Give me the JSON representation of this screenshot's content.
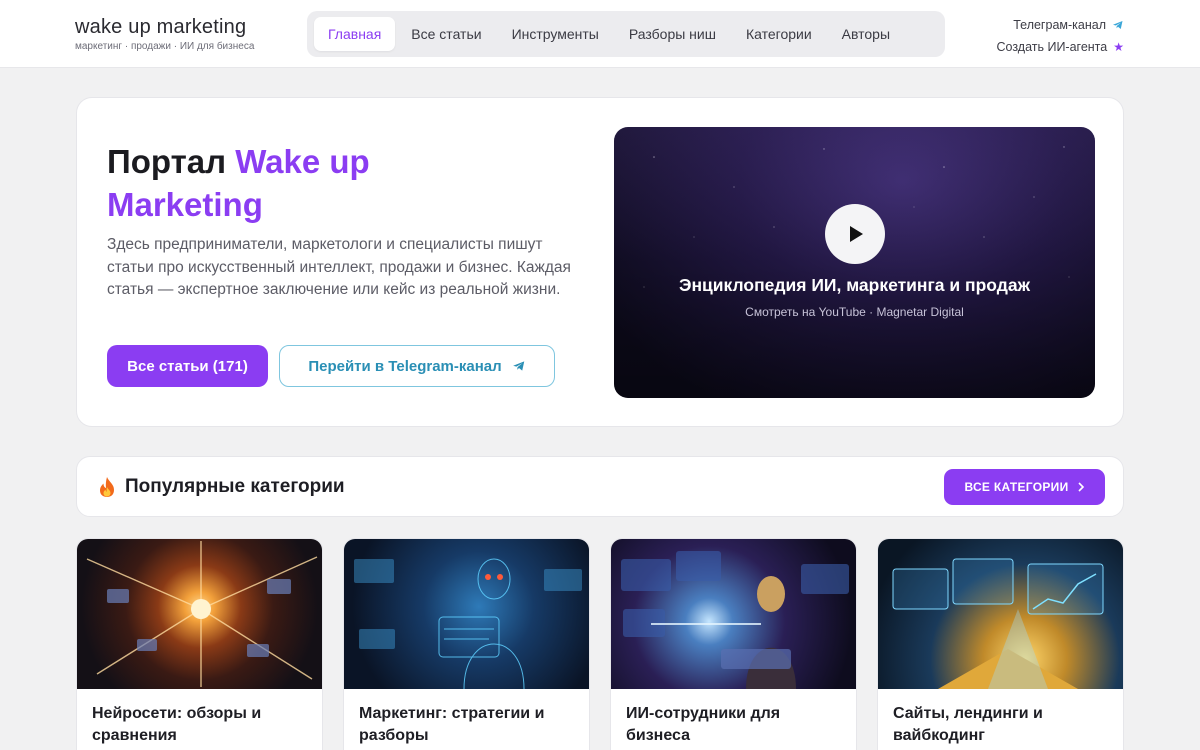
{
  "header": {
    "logo_title": "wake up marketing",
    "logo_sub": "маркетинг · продажи · ИИ для бизнеса",
    "nav": [
      {
        "label": "Главная",
        "active": true
      },
      {
        "label": "Все статьи"
      },
      {
        "label": "Инструменты"
      },
      {
        "label": "Разборы ниш"
      },
      {
        "label": "Категории"
      },
      {
        "label": "Авторы"
      }
    ],
    "telegram_link": "Телеграм-канал",
    "create_agent_link": "Создать ИИ-агента"
  },
  "hero": {
    "title_plain": "Портал ",
    "title_accent": "Wake up Marketing",
    "description": "Здесь предприниматели, маркетологи и специалисты пишут статьи про искусственный интеллект, продажи и бизнес. Каждая статья — экспертное заключение или кейс из реальной жизни.",
    "primary_button": "Все статьи (171)",
    "secondary_button": "Перейти в Telegram-канал",
    "video_title": "Энциклопедия ИИ, маркетинга и продаж",
    "video_subtitle": "Смотреть на YouTube · Magnetar Digital"
  },
  "categories": {
    "title": "Популярные категории",
    "all_button": "ВСЕ КАТЕГОРИИ",
    "cards": [
      {
        "title": "Нейросети: обзоры и сравнения"
      },
      {
        "title": "Маркетинг: стратегии и разборы"
      },
      {
        "title": "ИИ-сотрудники для бизнеса"
      },
      {
        "title": "Сайты, лендинги и вайбкодинг"
      }
    ]
  },
  "colors": {
    "accent": "#8b3df2",
    "telegram": "#2a8fb5",
    "background": "#f1f1f2"
  }
}
